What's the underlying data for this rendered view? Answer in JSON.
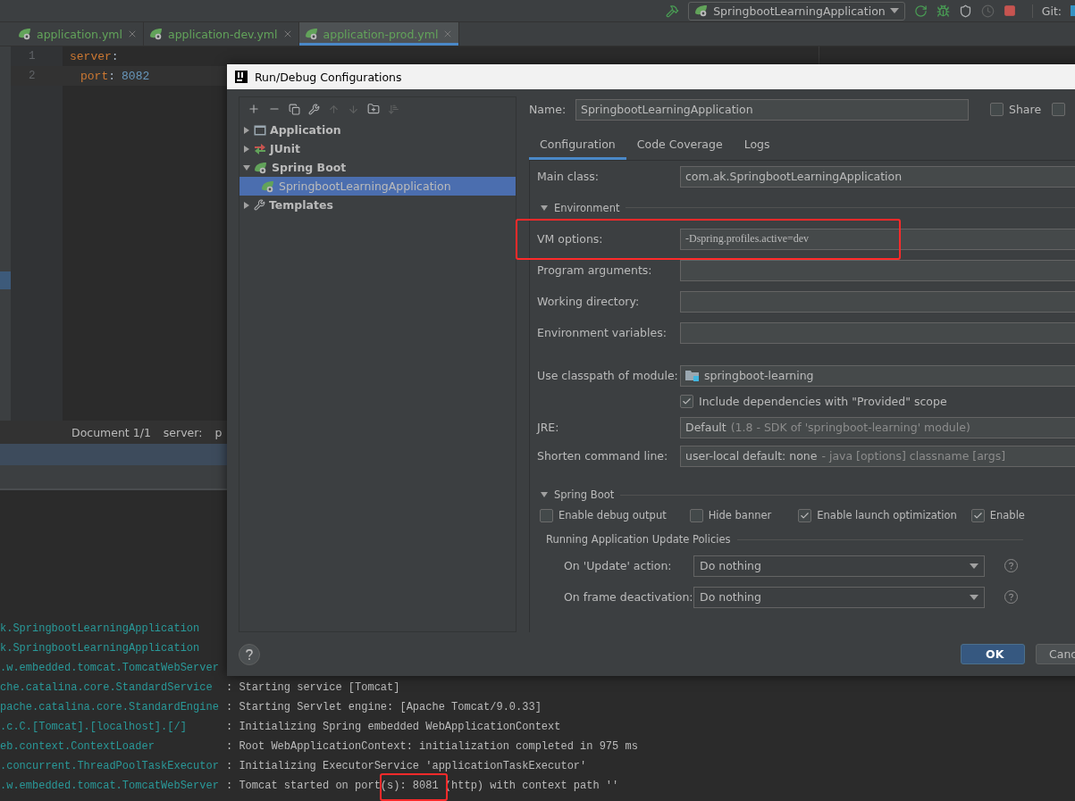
{
  "toolbar": {
    "run_config": "SpringbootLearningApplication",
    "git_label": "Git:"
  },
  "editor_tabs": [
    {
      "label": "application.yml",
      "selected": false
    },
    {
      "label": "application-dev.yml",
      "selected": false
    },
    {
      "label": "application-prod.yml",
      "selected": true
    }
  ],
  "editor": {
    "lines": [
      {
        "number": "1",
        "tokens": [
          {
            "text": "server",
            "kind": "key"
          },
          {
            "text": ":",
            "kind": "punct"
          }
        ],
        "children": [
          {
            "number": "2",
            "tokens": [
              {
                "text": "port",
                "kind": "key"
              },
              {
                "text": ":",
                "kind": "punct"
              },
              {
                "text": "8082",
                "kind": "number"
              }
            ]
          }
        ]
      }
    ]
  },
  "breadcrumb": [
    "Document 1/1",
    "server:",
    "p"
  ],
  "console": [
    {
      "source": "k.SpringbootLearningApplication"
    },
    {
      "source": "k.SpringbootLearningApplication"
    },
    {
      "source": ".w.embedded.tomcat.TomcatWebServer"
    },
    {
      "source": "che.catalina.core.StandardService",
      "message": ": Starting service [Tomcat]"
    },
    {
      "source": "pache.catalina.core.StandardEngine",
      "message": ": Starting Servlet engine: [Apache Tomcat/9.0.33]"
    },
    {
      "source": ".c.C.[Tomcat].[localhost].[/]",
      "message": ": Initializing Spring embedded WebApplicationContext"
    },
    {
      "source": "eb.context.ContextLoader",
      "message": ": Root WebApplicationContext: initialization completed in 975 ms"
    },
    {
      "source": ".concurrent.ThreadPoolTaskExecutor",
      "message": ": Initializing ExecutorService 'applicationTaskExecutor'"
    },
    {
      "source": ".w.embedded.tomcat.TomcatWebServer",
      "message": ": Tomcat started on port(s): 8081 (http) with context path ''"
    }
  ],
  "dialog": {
    "title": "Run/Debug Configurations",
    "tree": [
      {
        "label": "Application",
        "kind": "application",
        "expanded": false,
        "selected": false
      },
      {
        "label": "JUnit",
        "kind": "junit",
        "expanded": false,
        "selected": false
      },
      {
        "label": "Spring Boot",
        "kind": "spring",
        "expanded": true,
        "selected": false,
        "children": [
          {
            "label": "SpringbootLearningApplication",
            "kind": "spring",
            "selected": true
          }
        ]
      },
      {
        "label": "Templates",
        "kind": "templates",
        "expanded": false,
        "selected": false
      }
    ],
    "name": {
      "label": "Name:",
      "value": "SpringbootLearningApplication"
    },
    "share": {
      "label": "Share",
      "checked": false
    },
    "extra_checkbox": {
      "checked": false
    },
    "tabs": [
      {
        "label": "Configuration",
        "selected": true
      },
      {
        "label": "Code Coverage",
        "selected": false
      },
      {
        "label": "Logs",
        "selected": false
      }
    ],
    "main_class": {
      "label": "Main class:",
      "value": "com.ak.SpringbootLearningApplication"
    },
    "environment": {
      "title": "Environment",
      "expanded": true,
      "fields": [
        {
          "label": "VM options:",
          "value": "-Dspring.profiles.active=dev"
        },
        {
          "label": "Program arguments:"
        },
        {
          "label": "Working directory:"
        },
        {
          "label": "Environment variables:"
        }
      ]
    },
    "module": {
      "label": "Use classpath of module:",
      "value": "springboot-learning"
    },
    "include_provided": {
      "label": "Include dependencies with \"Provided\" scope",
      "checked": true
    },
    "jre": {
      "label": "JRE:",
      "value": "Default",
      "hint": "(1.8 - SDK of 'springboot-learning' module)"
    },
    "shorten": {
      "label": "Shorten command line:",
      "value": "user-local default: none",
      "hint": "- java [options] classname [args]"
    },
    "spring_boot": {
      "title": "Spring Boot",
      "expanded": true,
      "options": [
        {
          "label": "Enable debug output",
          "checked": false
        },
        {
          "label": "Hide banner",
          "checked": false
        },
        {
          "label": "Enable launch optimization",
          "checked": true
        },
        {
          "label": "Enable",
          "checked": true
        }
      ],
      "policies": {
        "title": "Running Application Update Policies",
        "rows": [
          {
            "label": "On 'Update' action:",
            "value": "Do nothing"
          },
          {
            "label": "On frame deactivation:",
            "value": "Do nothing"
          }
        ]
      }
    },
    "buttons": [
      {
        "label": "OK",
        "kind": "default"
      },
      {
        "label": "Canc",
        "kind": "normal"
      }
    ]
  }
}
